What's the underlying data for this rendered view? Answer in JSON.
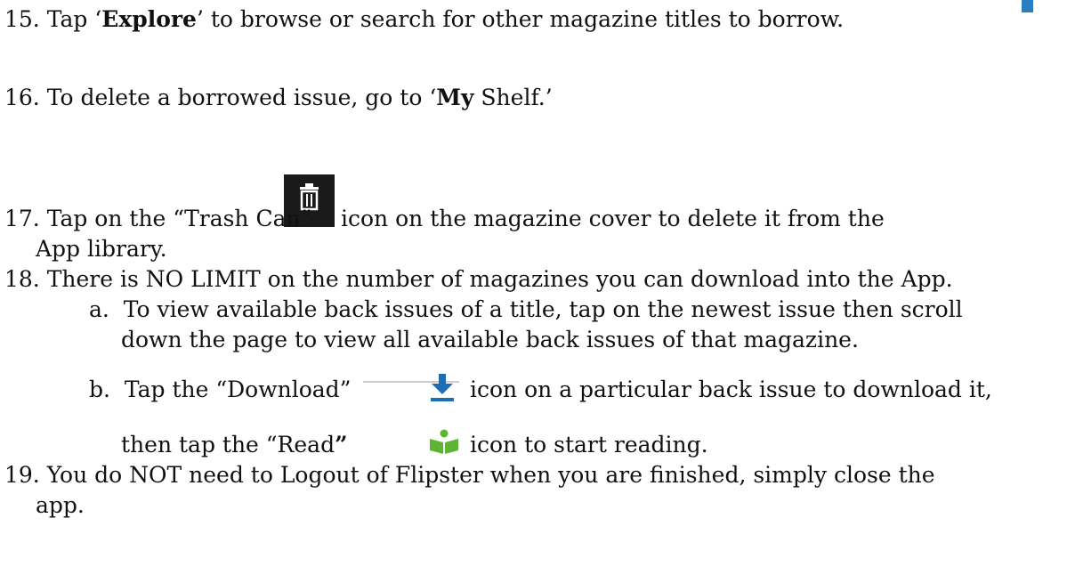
{
  "steps": {
    "s15": {
      "num": "15.",
      "pre": "Tap ‘",
      "bold": "Explore",
      "post": "’ to browse or search for other magazine titles to borrow."
    },
    "s16": {
      "num": "16.",
      "pre": "To delete a borrowed issue, go to ‘",
      "bold": "My",
      "post": " Shelf.’"
    },
    "s17": {
      "num": "17.",
      "pre": "Tap on the “Trash Can”",
      "post": "icon on the magazine cover to delete it from the",
      "cont": "App library."
    },
    "s18": {
      "num": "18.",
      "text": "There is NO LIMIT on the number of magazines you can download into the App.",
      "a": {
        "label": "a.",
        "line1": "To view available back issues of a title, tap on the newest issue then scroll",
        "line2": "down the page to view all available back issues of that magazine."
      },
      "b": {
        "label": "b.",
        "pre": "Tap the “Download”",
        "post": "icon on a particular back issue to download it,",
        "line2_pre": "then tap the “Read",
        "line2_bold": "”",
        "line2_post": "icon to start reading."
      }
    },
    "s19": {
      "num": "19.",
      "line1": "You do NOT need to Logout of Flipster when you are finished, simply close the",
      "line2": "app."
    }
  },
  "icons": {
    "trash": "trash-can-icon",
    "download": "download-icon",
    "read": "read-book-icon"
  },
  "colors": {
    "trash_bg": "#1a1a1a",
    "download": "#1b6fb5",
    "read": "#5cb533"
  }
}
